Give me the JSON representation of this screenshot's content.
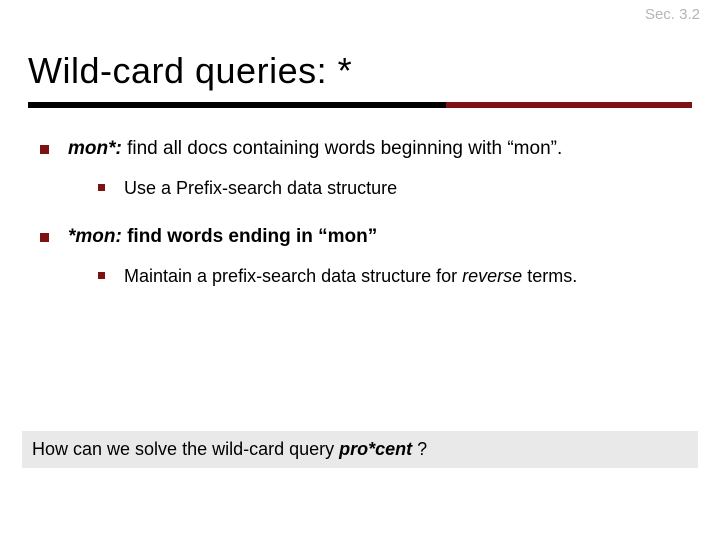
{
  "section_label": "Sec. 3.2",
  "title": "Wild-card queries: *",
  "bullets": [
    {
      "lead": "mon*:",
      "rest_a": " find all docs containing words beginning with ",
      "quote": "“mon”",
      "rest_b": ".",
      "sub": {
        "text": "Use a Prefix-search data structure"
      }
    },
    {
      "lead": "*mon:",
      "rest_a": " find words ending in ",
      "quote": "“mon”",
      "rest_b": "",
      "sub": {
        "text_a": "Maintain a prefix-search data structure for ",
        "em": "reverse",
        "text_b": " terms."
      }
    }
  ],
  "question": {
    "pre": "How can we solve the wild-card query ",
    "strong": "pro*cent",
    "post": " ?"
  }
}
